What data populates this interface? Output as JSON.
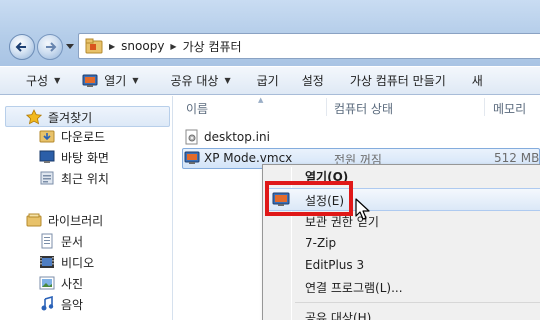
{
  "address": {
    "crumbs": [
      "snoopy",
      "가상 컴퓨터"
    ]
  },
  "toolbar": {
    "organize": "구성",
    "open": "열기",
    "share": "공유 대상",
    "burn": "굽기",
    "settings": "설정",
    "create_vm": "가상 컴퓨터 만들기",
    "new_folder": "새"
  },
  "nav": {
    "favorites": "즐겨찾기",
    "downloads": "다운로드",
    "desktop": "바탕 화면",
    "recent": "최근 위치",
    "libraries": "라이브러리",
    "documents": "문서",
    "videos": "비디오",
    "pictures": "사진",
    "music": "음악"
  },
  "columns": {
    "name": "이름",
    "status": "컴퓨터 상태",
    "memory": "메모리"
  },
  "files": [
    {
      "name": "desktop.ini",
      "status": "",
      "memory": ""
    },
    {
      "name": "XP Mode.vmcx",
      "status": "전원 꺼짐",
      "memory": "512 MB"
    }
  ],
  "context_menu": {
    "items": [
      {
        "label": "열기(O)"
      },
      {
        "label": "설정(E)"
      },
      {
        "label": "보관 권한 얻기"
      },
      {
        "label": "7-Zip"
      },
      {
        "label": "EditPlus 3"
      },
      {
        "label": "연결 프로그램(L)..."
      },
      {
        "label": "공유 대상(H)"
      }
    ]
  },
  "colors": {
    "highlight_box": "#e01818",
    "selection": "#d3e4f8",
    "menu_bg": "#f0f0f0"
  },
  "icons": [
    "back-arrow-icon",
    "forward-arrow-icon",
    "folder-icon",
    "vm-icon",
    "star-icon",
    "downloads-folder-icon",
    "desktop-icon",
    "recent-places-icon",
    "library-icon",
    "documents-icon",
    "videos-icon",
    "pictures-icon",
    "music-icon",
    "settings-file-icon",
    "mouse-cursor-icon"
  ]
}
